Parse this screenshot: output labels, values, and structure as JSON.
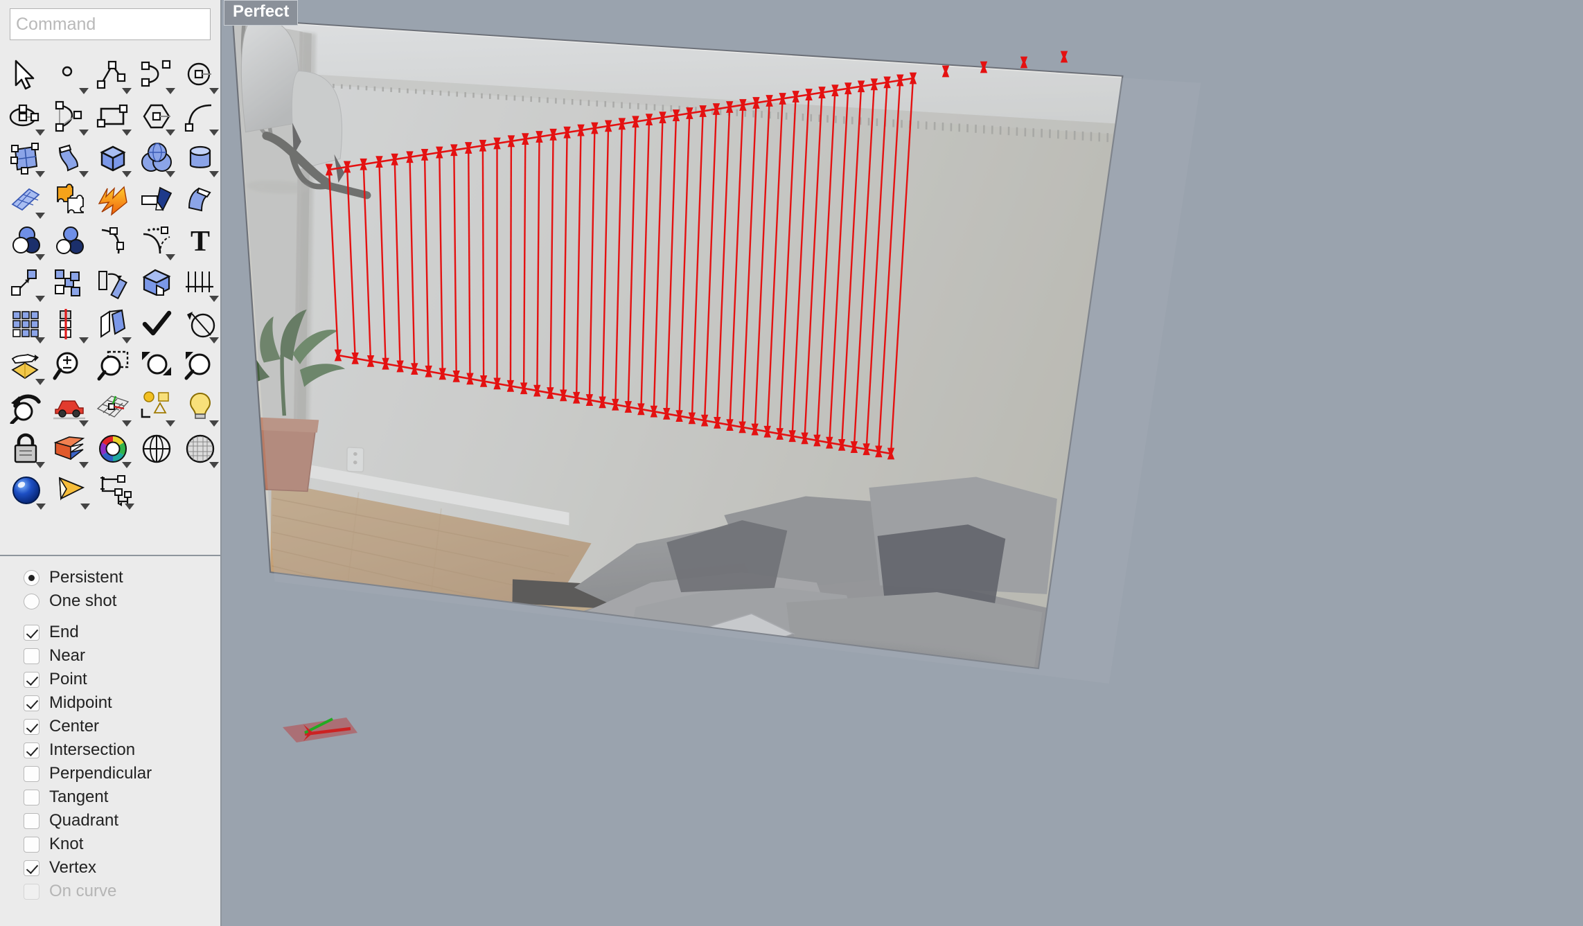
{
  "app": {
    "viewport_label": "Perfect",
    "background_color": "#9aa3ae",
    "panel_color": "#ebebeb"
  },
  "command": {
    "placeholder": "Command",
    "value": ""
  },
  "toolbar": {
    "rows": [
      [
        {
          "name": "select-arrow-icon",
          "label": "Select",
          "flyout": false
        },
        {
          "name": "point-icon",
          "label": "Point",
          "flyout": true
        },
        {
          "name": "polyline-icon",
          "label": "Polyline",
          "flyout": true
        },
        {
          "name": "curve-control-points-icon",
          "label": "Curve",
          "flyout": true
        },
        {
          "name": "circle-icon",
          "label": "Circle",
          "flyout": true
        }
      ],
      [
        {
          "name": "ellipse-icon",
          "label": "Ellipse",
          "flyout": true
        },
        {
          "name": "arc-icon",
          "label": "Arc",
          "flyout": true
        },
        {
          "name": "rectangle-icon",
          "label": "Rectangle",
          "flyout": true
        },
        {
          "name": "polygon-icon",
          "label": "Polygon",
          "flyout": true
        },
        {
          "name": "conic-icon",
          "label": "Conic",
          "flyout": true
        }
      ],
      [
        {
          "name": "surface-from-points-icon",
          "label": "Surface from points",
          "flyout": true
        },
        {
          "name": "sweep-surface-icon",
          "label": "Sweep",
          "flyout": true
        },
        {
          "name": "box-solid-icon",
          "label": "Box",
          "flyout": true
        },
        {
          "name": "sphere-solid-icon",
          "label": "Sphere",
          "flyout": true
        },
        {
          "name": "cylinder-solid-icon",
          "label": "Cylinder",
          "flyout": true
        }
      ],
      [
        {
          "name": "mesh-plane-icon",
          "label": "Mesh",
          "flyout": true
        },
        {
          "name": "boolean-puzzle-icon",
          "label": "Boolean",
          "flyout": false
        },
        {
          "name": "explode-icon",
          "label": "Explode",
          "flyout": false
        },
        {
          "name": "paint-wedge-icon",
          "label": "Paint",
          "flyout": false
        },
        {
          "name": "unroll-surface-icon",
          "label": "Unroll",
          "flyout": false
        }
      ],
      [
        {
          "name": "boolean-union-icon",
          "label": "Boolean union",
          "flyout": true
        },
        {
          "name": "boolean-split-icon",
          "label": "Split",
          "flyout": false
        },
        {
          "name": "curve-edit-icon",
          "label": "Edit curve",
          "flyout": false
        },
        {
          "name": "curve-extend-icon",
          "label": "Extend",
          "flyout": true
        },
        {
          "name": "text-tool-icon",
          "label": "Text",
          "flyout": false
        }
      ],
      [
        {
          "name": "move-icon",
          "label": "Move",
          "flyout": true
        },
        {
          "name": "copy-icon",
          "label": "Copy",
          "flyout": false
        },
        {
          "name": "rotate-icon",
          "label": "Rotate",
          "flyout": false
        },
        {
          "name": "boolean-difference-icon",
          "label": "Difference",
          "flyout": false
        },
        {
          "name": "dimension-icon",
          "label": "Dimension",
          "flyout": true
        }
      ],
      [
        {
          "name": "array-grid-icon",
          "label": "Array",
          "flyout": true
        },
        {
          "name": "mirror-icon",
          "label": "Mirror",
          "flyout": true
        },
        {
          "name": "offset-icon",
          "label": "Offset",
          "flyout": true
        },
        {
          "name": "check-select-icon",
          "label": "Select objects",
          "flyout": false
        },
        {
          "name": "trim-icon",
          "label": "Trim",
          "flyout": true
        }
      ],
      [
        {
          "name": "drape-icon",
          "label": "Drape",
          "flyout": true
        },
        {
          "name": "zoom-scale-icon",
          "label": "Zoom scale",
          "flyout": false
        },
        {
          "name": "zoom-window-icon",
          "label": "Zoom window",
          "flyout": false
        },
        {
          "name": "zoom-extents-icon",
          "label": "Zoom extents",
          "flyout": false
        },
        {
          "name": "zoom-selected-icon",
          "label": "Zoom selected",
          "flyout": false
        }
      ],
      [
        {
          "name": "undo-view-icon",
          "label": "Undo view",
          "flyout": false
        },
        {
          "name": "pan-car-icon",
          "label": "Pan",
          "flyout": true
        },
        {
          "name": "cplane-grid-icon",
          "label": "CPlane",
          "flyout": true
        },
        {
          "name": "layout-icon",
          "label": "Layout",
          "flyout": true
        },
        {
          "name": "light-icon",
          "label": "Light",
          "flyout": true
        }
      ],
      [
        {
          "name": "lock-icon",
          "label": "Lock",
          "flyout": true
        },
        {
          "name": "layers-icon",
          "label": "Layers",
          "flyout": true
        },
        {
          "name": "color-wheel-icon",
          "label": "Color",
          "flyout": true
        },
        {
          "name": "shade-sphere-icon",
          "label": "Shade",
          "flyout": false
        },
        {
          "name": "render-mesh-icon",
          "label": "Render mesh",
          "flyout": true
        }
      ],
      [
        {
          "name": "render-sphere-icon",
          "label": "Render",
          "flyout": true
        },
        {
          "name": "camera-cone-icon",
          "label": "Camera",
          "flyout": true
        },
        {
          "name": "block-tree-icon",
          "label": "Blocks",
          "flyout": true
        }
      ]
    ]
  },
  "osnap": {
    "modes": [
      {
        "name": "persistent",
        "label": "Persistent",
        "selected": true
      },
      {
        "name": "one-shot",
        "label": "One shot",
        "selected": false
      }
    ],
    "snaps": [
      {
        "name": "end",
        "label": "End",
        "checked": true,
        "disabled": false
      },
      {
        "name": "near",
        "label": "Near",
        "checked": false,
        "disabled": false
      },
      {
        "name": "point",
        "label": "Point",
        "checked": true,
        "disabled": false
      },
      {
        "name": "midpoint",
        "label": "Midpoint",
        "checked": true,
        "disabled": false
      },
      {
        "name": "center",
        "label": "Center",
        "checked": true,
        "disabled": false
      },
      {
        "name": "intersection",
        "label": "Intersection",
        "checked": true,
        "disabled": false
      },
      {
        "name": "perpendicular",
        "label": "Perpendicular",
        "checked": false,
        "disabled": false
      },
      {
        "name": "tangent",
        "label": "Tangent",
        "checked": false,
        "disabled": false
      },
      {
        "name": "quadrant",
        "label": "Quadrant",
        "checked": false,
        "disabled": false
      },
      {
        "name": "knot",
        "label": "Knot",
        "checked": false,
        "disabled": false
      },
      {
        "name": "vertex",
        "label": "Vertex",
        "checked": true,
        "disabled": false
      },
      {
        "name": "on-curve",
        "label": "On curve",
        "checked": false,
        "disabled": true
      }
    ]
  },
  "scene": {
    "geometry_color": "#e41111",
    "picture_frame": {
      "note": "photo-textured picture plane of a living room: white wall, ceiling lamp, plant, gray sectional sofa, laptop, wood floor, baseboard heater"
    },
    "curve_count": 43,
    "marker_shape": "bowtie",
    "origin_gizmo": {
      "x_axis_color": "#cc2222",
      "y_axis_color": "#22aa22"
    }
  }
}
